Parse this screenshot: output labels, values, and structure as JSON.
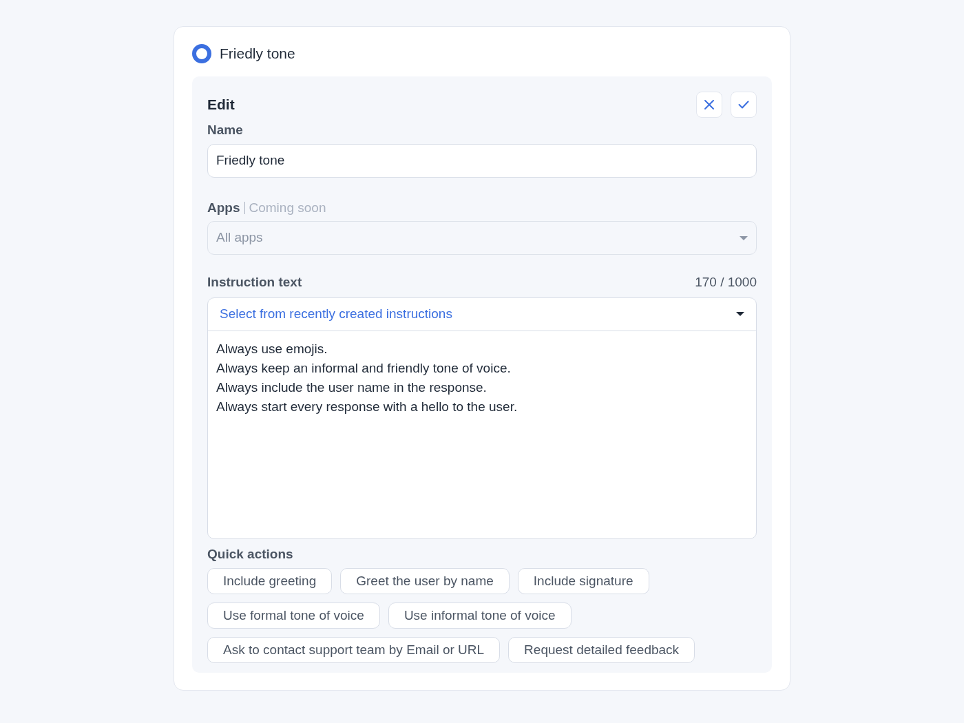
{
  "header": {
    "title": "Friedly tone",
    "selected": true
  },
  "edit": {
    "title": "Edit"
  },
  "name_field": {
    "label": "Name",
    "value": "Friedly tone"
  },
  "apps_field": {
    "label": "Apps",
    "note": "Coming soon",
    "value": "All apps",
    "disabled": true
  },
  "instruction": {
    "label": "Instruction text",
    "counter": "170 / 1000",
    "picker": "Select from recently created instructions",
    "text": "Always use emojis.\nAlways keep an informal and friendly tone of voice.\nAlways include the user name in the response.\nAlways start every response with a hello to the user."
  },
  "quick_actions": {
    "label": "Quick actions",
    "rows": [
      [
        "Include greeting",
        "Greet the user by name",
        "Include signature"
      ],
      [
        "Use formal tone of voice",
        "Use informal tone of voice"
      ],
      [
        "Ask to contact support team by Email or URL",
        "Request detailed feedback"
      ]
    ]
  }
}
